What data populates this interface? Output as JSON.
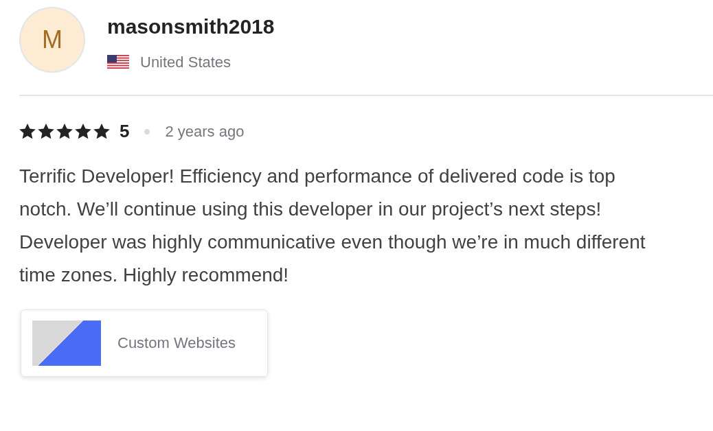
{
  "reviewer": {
    "initial": "M",
    "username": "masonsmith2018",
    "country": "United States"
  },
  "review": {
    "stars": 5,
    "rating": "5",
    "time": "2 years ago",
    "text": "Terrific Developer! Efficiency and performance of delivered code is top notch. We’ll continue using this developer in our project’s next steps! Developer was highly communicative even though we’re in much different time zones. Highly recommend!"
  },
  "gig": {
    "title": "Custom Websites"
  }
}
